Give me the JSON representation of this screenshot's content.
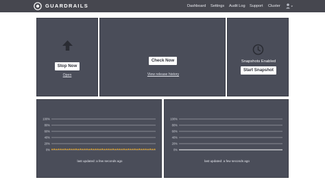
{
  "header": {
    "brand": "GUARDRAILS",
    "nav": [
      "Dashboard",
      "Settings",
      "Audit Log",
      "Support",
      "Cluster"
    ]
  },
  "monitor": {
    "stop_label": "Stop Now",
    "open_label": "Open"
  },
  "updates": {
    "check_label": "Check Now",
    "history_label": "View release history"
  },
  "snapshots": {
    "status": "Snapshots Enabled",
    "start_label": "Start Snapshot"
  },
  "charts": [
    {
      "updated": "last updated: a few seconds ago"
    },
    {
      "updated": "last updated: a few seconds ago"
    }
  ],
  "colors": {
    "topbar": "#46474f",
    "panel": "#4a4d59",
    "series_left": "#e0a020",
    "series_right": "#ffffff"
  },
  "chart_data": [
    {
      "type": "line",
      "y_ticks": [
        "100%",
        "80%",
        "60%",
        "40%",
        "20%",
        "0%"
      ],
      "ylim": [
        0,
        100
      ],
      "series": [
        {
          "values": [
            1,
            2,
            1,
            2,
            1,
            2,
            1,
            2,
            1,
            2,
            1,
            2,
            1,
            2,
            1,
            2,
            1,
            2,
            1,
            2,
            1,
            2,
            1,
            2,
            1,
            2,
            1,
            2,
            1,
            2,
            1,
            2,
            1,
            2,
            1,
            2,
            1,
            2,
            1,
            2
          ]
        }
      ]
    },
    {
      "type": "line",
      "y_ticks": [
        "100%",
        "80%",
        "60%",
        "40%",
        "20%",
        "0%"
      ],
      "ylim": [
        0,
        100
      ],
      "series": [
        {
          "values": [
            0,
            0,
            0,
            0,
            0,
            0,
            0,
            0,
            0,
            0
          ]
        }
      ]
    }
  ]
}
